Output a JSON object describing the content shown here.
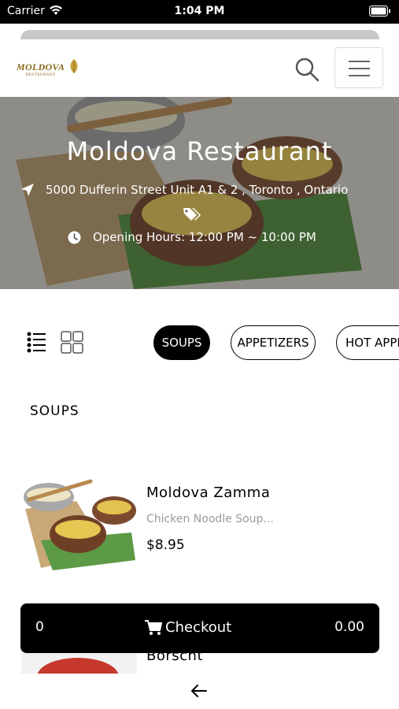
{
  "status_bar": {
    "carrier": "Carrier",
    "time": "1:04 PM"
  },
  "header": {
    "logo_text": "MOLDOVA",
    "logo_subtext": "RESTAURANT",
    "search_icon": "search-icon",
    "menu_icon": "hamburger-menu-icon"
  },
  "hero": {
    "title": "Moldova Restaurant",
    "address": "5000 Dufferin Street Unit A1 & 2 , Toronto , Ontario",
    "hours": "Opening Hours: 12:00 PM ~ 10:00 PM"
  },
  "categories": [
    {
      "label": "SOUPS",
      "active": true
    },
    {
      "label": "APPETIZERS",
      "active": false
    },
    {
      "label": "HOT APPE",
      "active": false
    }
  ],
  "section_title": "SOUPS",
  "items": [
    {
      "name": "Moldova Zamma",
      "description": "Chicken Noodle Soup...",
      "price": "$8.95"
    },
    {
      "name": "Borscht"
    }
  ],
  "checkout": {
    "count": "0",
    "label": "Checkout",
    "total": "0.00"
  },
  "colors": {
    "accent": "#000000",
    "hero_overlay": "#3a3a3a",
    "muted_text": "#9a9a9a"
  }
}
